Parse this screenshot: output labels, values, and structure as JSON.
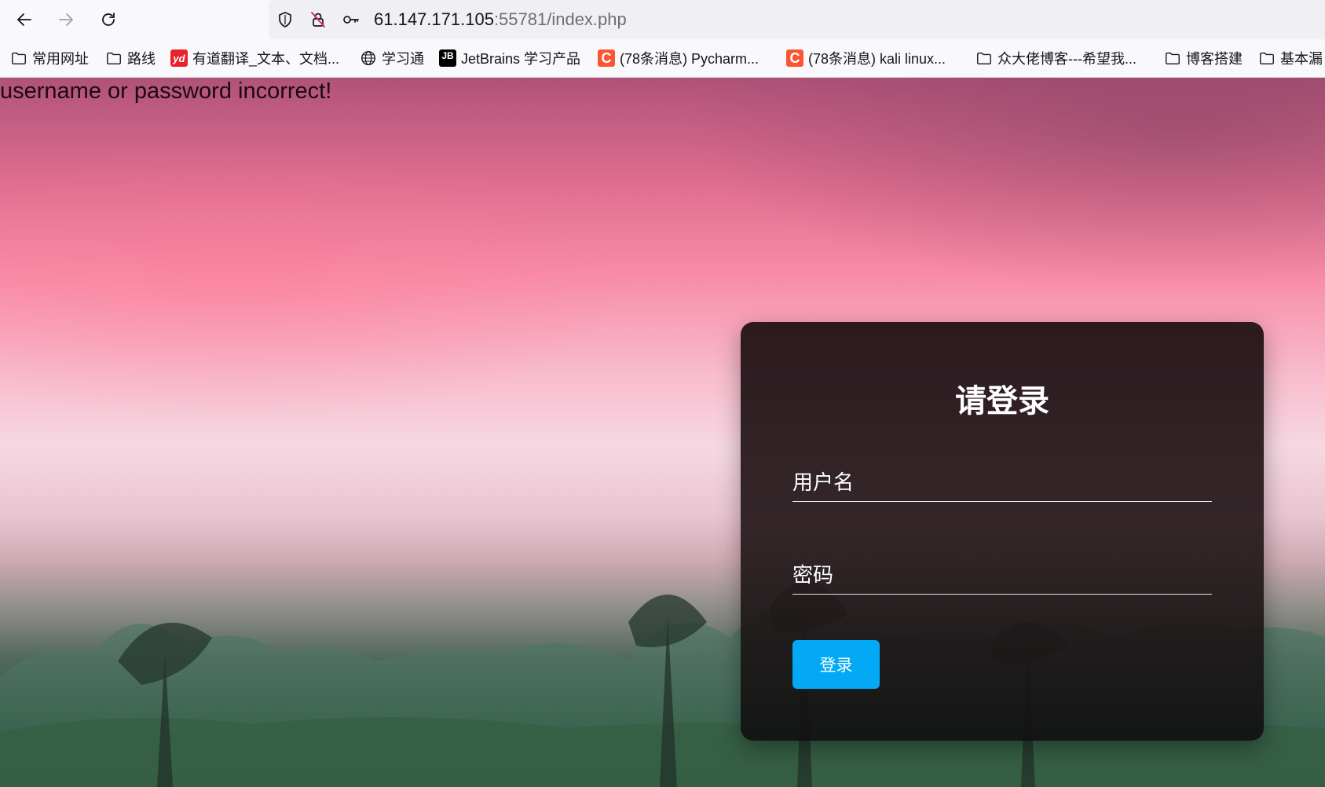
{
  "browser": {
    "url_host": "61.147.171.105",
    "url_rest": ":55781/index.php",
    "icons": [
      "back-icon",
      "forward-icon",
      "reload-icon",
      "shield-icon",
      "insecure-lock-icon",
      "key-icon"
    ]
  },
  "bookmarks": [
    {
      "label": "常用网址",
      "icon": "folder-icon"
    },
    {
      "label": "路线",
      "icon": "folder-icon"
    },
    {
      "label": "有道翻译_文本、文档...",
      "icon": "youdao-icon",
      "badge": "yd"
    },
    {
      "label": "学习通",
      "icon": "globe-icon"
    },
    {
      "label": "JetBrains 学习产品",
      "icon": "jetbrains-icon",
      "badge": "JB"
    },
    {
      "label": "(78条消息) Pycharm...",
      "icon": "csdn-icon",
      "badge": "C"
    },
    {
      "label": "(78条消息) kali linux...",
      "icon": "csdn-icon",
      "badge": "C"
    },
    {
      "label": "众大佬博客---希望我...",
      "icon": "folder-icon"
    },
    {
      "label": "博客搭建",
      "icon": "folder-icon"
    },
    {
      "label": "基本漏",
      "icon": "folder-icon"
    }
  ],
  "page": {
    "error_message": "username or password incorrect!"
  },
  "login": {
    "title": "请登录",
    "username_label": "用户名",
    "password_label": "密码",
    "submit_label": "登录",
    "button_color": "#03a9f4"
  }
}
